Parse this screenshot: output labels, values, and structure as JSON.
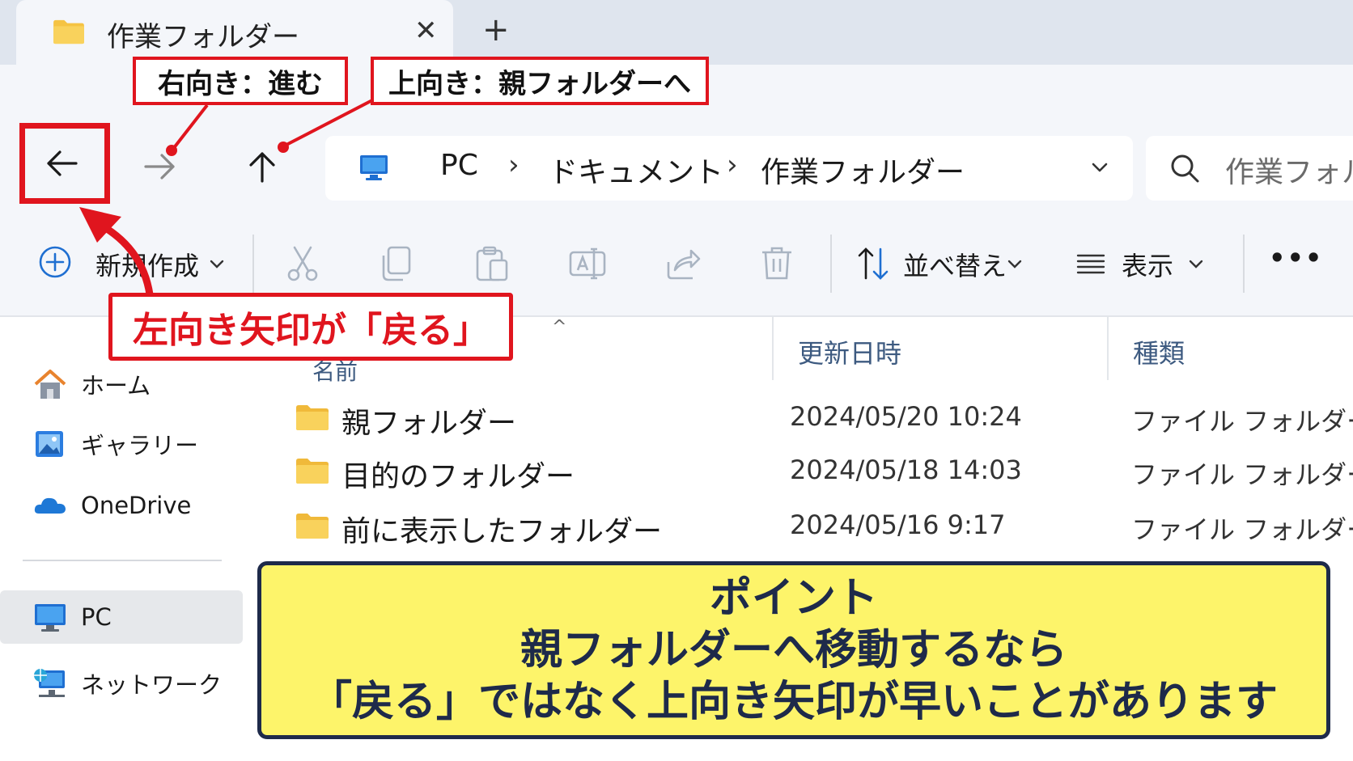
{
  "tab": {
    "title": "作業フォルダー",
    "close": "✕",
    "new_tab": "+"
  },
  "address": {
    "segments": [
      "PC",
      "ドキュメント",
      "作業フォルダー"
    ],
    "separator": "›"
  },
  "search": {
    "placeholder": "作業フォルダー"
  },
  "toolbar": {
    "new_label": "新規作成",
    "sort_label": "並べ替え",
    "view_label": "表示",
    "more": "•••",
    "icons": [
      "add-icon",
      "cut-icon",
      "copy-icon",
      "paste-icon",
      "rename-icon",
      "share-icon",
      "delete-icon",
      "sort-icon",
      "view-icon"
    ]
  },
  "columns": {
    "name": "名前",
    "date": "更新日時",
    "type": "種類"
  },
  "sidebar": {
    "items": [
      {
        "label": "ホーム",
        "icon": "home-icon"
      },
      {
        "label": "ギャラリー",
        "icon": "gallery-icon"
      },
      {
        "label": "OneDrive",
        "icon": "onedrive-icon"
      },
      {
        "label": "PC",
        "icon": "pc-icon"
      },
      {
        "label": "ネットワーク",
        "icon": "network-icon"
      }
    ]
  },
  "files": [
    {
      "name": "親フォルダー",
      "date": "2024/05/20 10:24",
      "type": "ファイル フォルダー"
    },
    {
      "name": "目的のフォルダー",
      "date": "2024/05/18 14:03",
      "type": "ファイル フォルダー"
    },
    {
      "name": "前に表示したフォルダー",
      "date": "2024/05/16 9:17",
      "type": "ファイル フォルダー"
    }
  ],
  "annotations": {
    "forward": "右向き：進む",
    "up": "上向き：親フォルダーへ",
    "back": "左向き矢印が「戻る」"
  },
  "point": {
    "title": "ポイント",
    "line1": "親フォルダーへ移動するなら",
    "line2": "「戻る」ではなく上向き矢印が早いことがあります"
  },
  "colors": {
    "accent_red": "#e0151e",
    "point_bg": "#fdf46a",
    "point_text": "#1e2a4a",
    "folder": "#f5c343"
  }
}
